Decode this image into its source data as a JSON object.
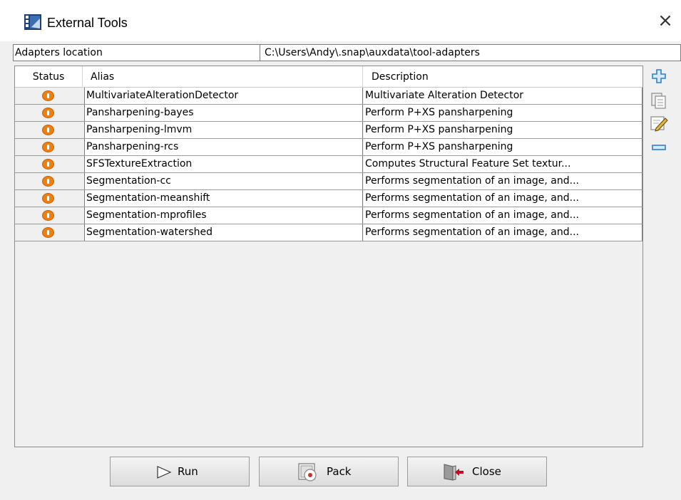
{
  "window": {
    "title": "External Tools",
    "close_glyph": "×",
    "icon": "external-tools-app-icon"
  },
  "location": {
    "label": "Adapters location",
    "value": "C:\\Users\\Andy\\.snap\\auxdata\\tool-adapters"
  },
  "table": {
    "headers": {
      "status": "Status",
      "alias": "Alias",
      "description": "Description"
    },
    "status_icon": "warning-icon",
    "status_color": "#f07f12",
    "rows": [
      {
        "alias": "MultivariateAlterationDetector",
        "description": "Multivariate Alteration Detector"
      },
      {
        "alias": "Pansharpening-bayes",
        "description": "Perform P+XS pansharpening"
      },
      {
        "alias": "Pansharpening-lmvm",
        "description": "Perform P+XS pansharpening"
      },
      {
        "alias": "Pansharpening-rcs",
        "description": "Perform P+XS pansharpening"
      },
      {
        "alias": "SFSTextureExtraction",
        "description": "Computes Structural Feature Set textur..."
      },
      {
        "alias": "Segmentation-cc",
        "description": "Performs segmentation of an image, and..."
      },
      {
        "alias": "Segmentation-meanshift",
        "description": "Performs segmentation of an image, and..."
      },
      {
        "alias": "Segmentation-mprofiles",
        "description": "Performs segmentation of an image, and..."
      },
      {
        "alias": "Segmentation-watershed",
        "description": "Performs segmentation of an image, and..."
      }
    ]
  },
  "side_toolbar": [
    {
      "icon": "add-icon",
      "color": "#2a7fd4"
    },
    {
      "icon": "copy-icon",
      "color": "#7a7a7a"
    },
    {
      "icon": "edit-icon",
      "color": "#d4a020"
    },
    {
      "icon": "remove-icon",
      "color": "#2a7fd4"
    }
  ],
  "buttons": {
    "run": {
      "label": "Run",
      "icon": "play-icon"
    },
    "pack": {
      "label": "Pack",
      "icon": "pack-icon"
    },
    "close": {
      "label": "Close",
      "icon": "exit-icon"
    }
  }
}
